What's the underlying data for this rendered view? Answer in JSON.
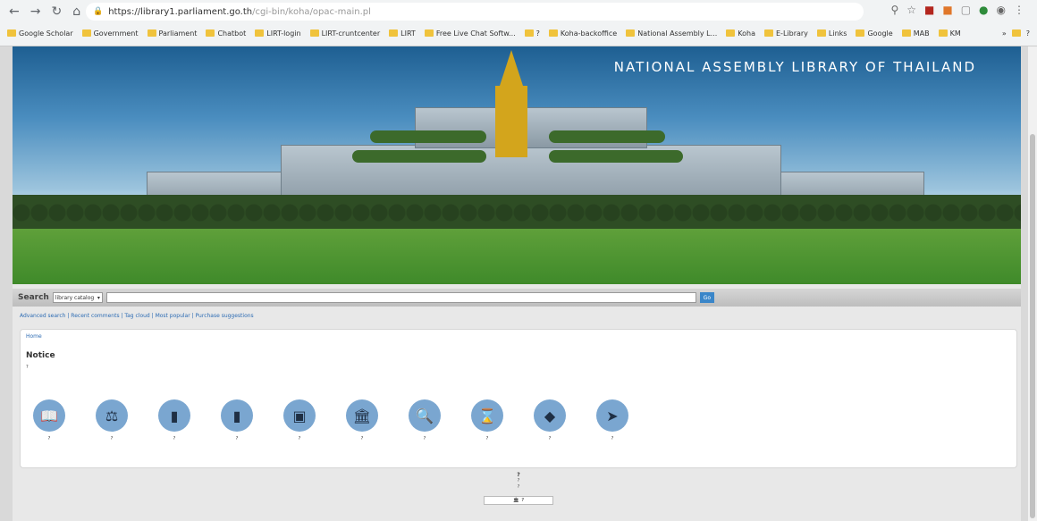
{
  "browser": {
    "url_host": "https://library1.parliament.go.th",
    "url_path": "/cgi-bin/koha/opac-main.pl",
    "bookmarks": [
      "Google Scholar",
      "Government",
      "Parliament",
      "Chatbot",
      "LIRT-login",
      "LIRT-cruntcenter",
      "LIRT",
      "Free Live Chat Softw...",
      "?",
      "Koha-backoffice",
      "National Assembly L...",
      "Koha",
      "E-Library",
      "Links",
      "Google",
      "MAB",
      "KM"
    ],
    "bookmark_end": "?"
  },
  "hero": {
    "title": "NATIONAL ASSEMBLY LIBRARY OF THAILAND"
  },
  "search": {
    "label": "Search",
    "select_value": "library catalog",
    "go_label": "Go"
  },
  "links_row": "Advanced search | Recent comments | Tag cloud | Most popular | Purchase suggestions",
  "breadcrumb": "Home",
  "notice": {
    "heading": "Notice",
    "body": "?"
  },
  "icons": [
    {
      "label": "?",
      "icon": "book-open-icon"
    },
    {
      "label": "?",
      "icon": "scales-icon"
    },
    {
      "label": "?",
      "icon": "book-icon"
    },
    {
      "label": "?",
      "icon": "book-icon"
    },
    {
      "label": "?",
      "icon": "contacts-icon"
    },
    {
      "label": "?",
      "icon": "building-icon"
    },
    {
      "label": "?",
      "icon": "search-document-icon"
    },
    {
      "label": "?",
      "icon": "hourglass-icon"
    },
    {
      "label": "?",
      "icon": "tag-icon"
    },
    {
      "label": "?",
      "icon": "sign-icon"
    }
  ],
  "footer": {
    "title": "?",
    "address": "?",
    "contact": "?",
    "badge": "?"
  },
  "colors": {
    "accent": "#3a86c9",
    "icon_circle": "#7aa6d0",
    "link": "#2c6bb3"
  }
}
